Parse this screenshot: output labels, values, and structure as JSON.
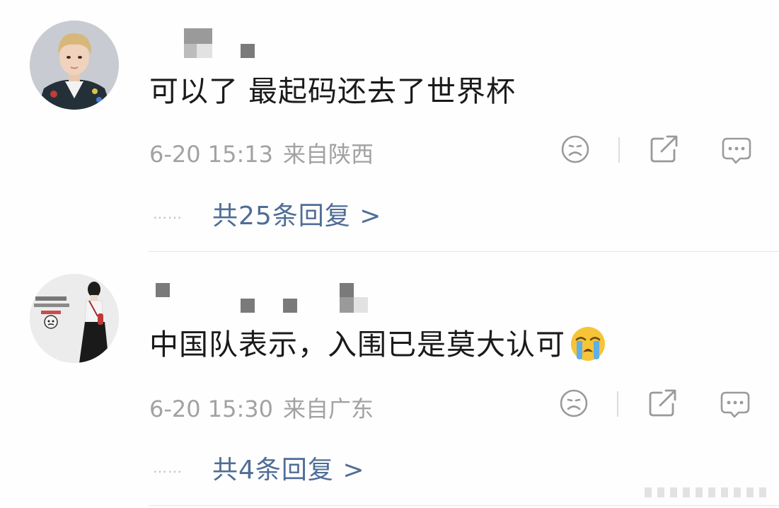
{
  "comments": [
    {
      "text": "可以了 最起码还去了世界杯",
      "time": "6-20 15:13",
      "location": "来自陕西",
      "replies_label": "共25条回复 >",
      "dots": "……"
    },
    {
      "text": "中国队表示，入围已是莫大认可",
      "time": "6-20 15:30",
      "location": "来自广东",
      "replies_label": "共4条回复 >",
      "dots": "……",
      "emoji": "loudly-crying-face"
    }
  ],
  "actions": {
    "dislike_icon": "frown-face-icon",
    "share_icon": "share-out-icon",
    "reply_icon": "speech-bubble-icon"
  },
  "colors": {
    "text": "#1a1a1a",
    "meta": "#a2a2a2",
    "link": "#4f6d96",
    "icon": "#9a9a9a"
  }
}
